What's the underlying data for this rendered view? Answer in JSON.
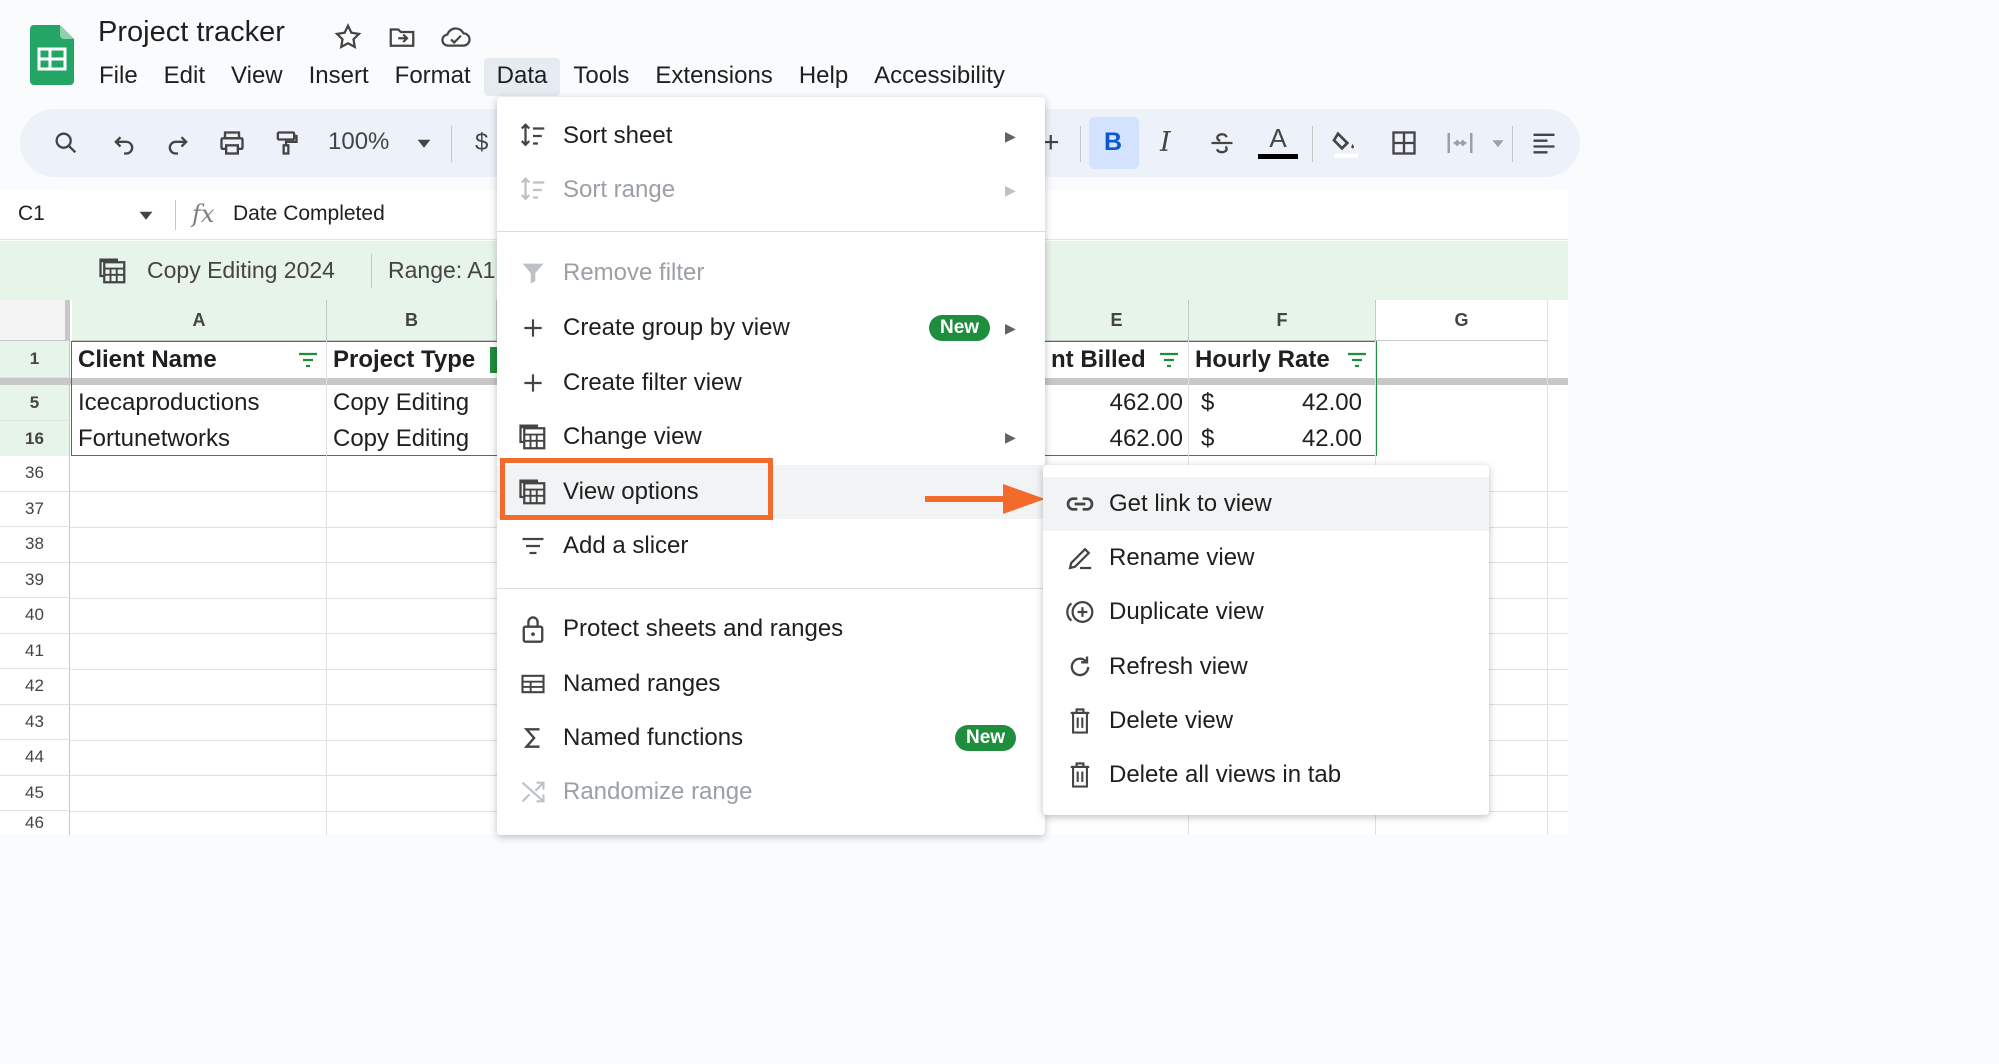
{
  "title": "Project tracker",
  "menubar": [
    "File",
    "Edit",
    "View",
    "Insert",
    "Format",
    "Data",
    "Tools",
    "Extensions",
    "Help",
    "Accessibility"
  ],
  "toolbar": {
    "zoom": "100%",
    "currency": "$",
    "bold": "B",
    "italic": "I",
    "text_color": "A",
    "plus": "+"
  },
  "formula_bar": {
    "cell_ref": "C1",
    "fx": "fx",
    "value": "Date Completed"
  },
  "view_bar": {
    "name": "Copy Editing 2024",
    "range_label": "Range:",
    "range_value": "A1"
  },
  "columns": [
    "A",
    "B",
    "E",
    "F",
    "G"
  ],
  "header_row": {
    "row": "1",
    "a": "Client Name",
    "b": "Project Type",
    "e": "nt Billed",
    "f": "Hourly Rate"
  },
  "rows": [
    {
      "num": "5",
      "a": "Icecaproductions",
      "b": "Copy Editing",
      "e": "462.00",
      "f_cur": "$",
      "f": "42.00"
    },
    {
      "num": "16",
      "a": "Fortunetworks",
      "b": "Copy Editing",
      "e": "462.00",
      "f_cur": "$",
      "f": "42.00"
    }
  ],
  "empty_rows": [
    "36",
    "37",
    "38",
    "39",
    "40",
    "41",
    "42",
    "43",
    "44",
    "45",
    "46"
  ],
  "data_menu": {
    "sort_sheet": "Sort sheet",
    "sort_range": "Sort range",
    "remove_filter": "Remove filter",
    "create_group": "Create group by view",
    "create_filter": "Create filter view",
    "change_view": "Change view",
    "view_options": "View options",
    "add_slicer": "Add a slicer",
    "protect": "Protect sheets and ranges",
    "named_ranges": "Named ranges",
    "named_functions": "Named functions",
    "randomize": "Randomize range",
    "badge_new": "New",
    "arrow": "▶"
  },
  "sub_menu": {
    "get_link": "Get link to view",
    "rename": "Rename view",
    "duplicate": "Duplicate view",
    "refresh": "Refresh view",
    "delete": "Delete view",
    "delete_all": "Delete all views in tab"
  },
  "colors": {
    "accent_green": "#1e8e3e",
    "highlight_orange": "#f26b2a",
    "filter_green_bg": "#e6f4ea"
  }
}
